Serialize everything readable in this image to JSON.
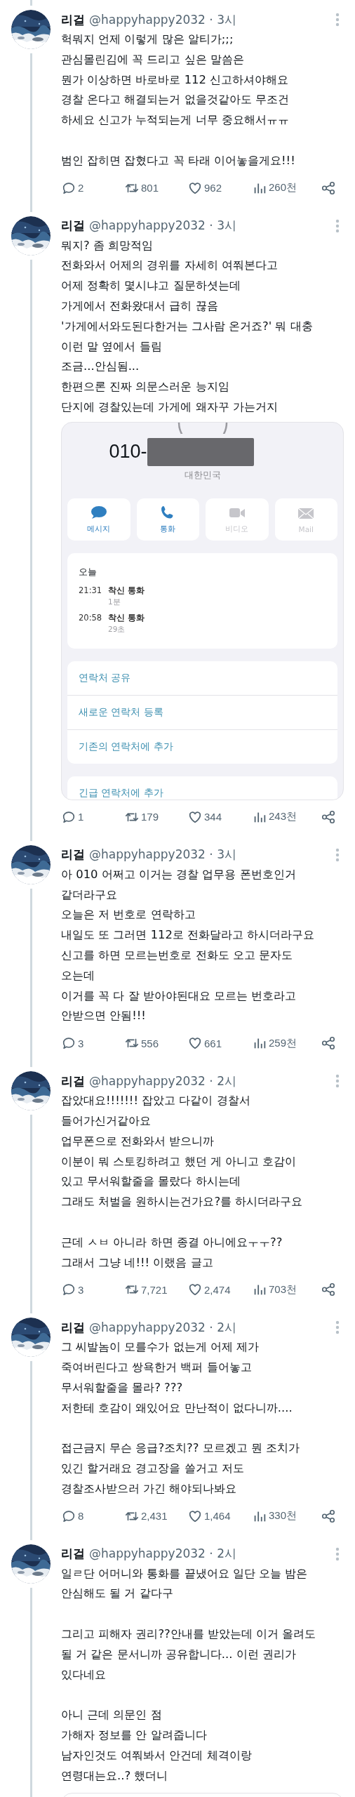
{
  "tweets": [
    {
      "name": "리걸",
      "byline": "@happyhappy2032 · 3시",
      "paragraphs": [
        "헉뭐지 언제 이렇게 많은 알티가;;;\n관심몰린김에 꼭 드리고 싶은 말씀은\n뭔가 이상하면 바로바로 112 신고하셔야해요\n경찰 온다고 해결되는거 없을것같아도 무조건\n하세요 신고가 누적되는게 너무 중요해서ㅠㅠ",
        "범인 잡히면 잡혔다고 꼭 타래 이어놓을게요!!!"
      ],
      "stats": {
        "replies": "2",
        "retweets": "801",
        "likes": "962",
        "views": "260천"
      }
    },
    {
      "name": "리걸",
      "byline": "@happyhappy2032 · 3시",
      "paragraphs": [
        "뭐지? 좀 희망적임\n전화와서 어제의 경위를 자세히 여쭤본다고\n어제 정확히 몇시냐고 질문하셧는데\n가게에서 전화왔대서 급히 끊음\n'가게에서와도된다한거는 그사람 온거죠?' 뭐 대충\n이런 말 옆에서 들림\n조금...안심됨...\n한편으론 진짜 의문스러운 능지임\n단지에 경찰있는데 가게에 왜자꾸 가는거지"
      ],
      "media": {
        "kind": "call_log",
        "number": "010-",
        "redacted": true,
        "region": "대한민국",
        "buttons": [
          {
            "kind": "message",
            "label": "메시지",
            "disabled": false
          },
          {
            "kind": "call",
            "label": "통화",
            "disabled": false
          },
          {
            "kind": "video",
            "label": "비디오",
            "disabled": true
          },
          {
            "kind": "mail",
            "label": "Mail",
            "disabled": true
          }
        ],
        "calls_heading": "오늘",
        "calls": [
          {
            "time": "21:31",
            "type": "착신 통화",
            "duration": "1분"
          },
          {
            "time": "20:58",
            "type": "착신 통화",
            "duration": "29초"
          }
        ],
        "actions": [
          "연락처 공유",
          "새로운 연락처 등록",
          "기존의 연락처에 추가"
        ],
        "emergency_action": "긴급 연락처에 추가"
      },
      "stats": {
        "replies": "1",
        "retweets": "179",
        "likes": "344",
        "views": "243천"
      }
    },
    {
      "name": "리걸",
      "byline": "@happyhappy2032 · 3시",
      "paragraphs": [
        "아 010 어쩌고 이거는 경찰 업무용 폰번호인거\n같더라구요\n오늘은 저 번호로 연락하고\n내일도 또 그러면 112로 전화달라고 하시더라구요\n신고를 하면 모르는번호로 전화도 오고 문자도\n오는데\n이거를 꼭 다 잘 받아야된대요 모르는 번호라고\n안받으면 안됨!!!"
      ],
      "stats": {
        "replies": "3",
        "retweets": "556",
        "likes": "661",
        "views": "259천"
      }
    },
    {
      "name": "리걸",
      "byline": "@happyhappy2032 · 2시",
      "paragraphs": [
        "잡았대요!!!!!!! 잡았고 다같이 경찰서\n들어가신거같아요\n업무폰으로 전화와서 받으니까\n이분이 뭐 스토킹하려고 했던 게 아니고 호감이\n있고 무서워할줄을 몰랐다 하시는데\n그래도 처벌을 원하시는건가요?를 하시더라구요",
        "근데 ㅅㅂ 아니라 하면 종결 아니에요ㅜㅜ??\n그래서 그냥 네!!! 이랬음 글고"
      ],
      "stats": {
        "replies": "3",
        "retweets": "7,721",
        "likes": "2,474",
        "views": "703천"
      }
    },
    {
      "name": "리걸",
      "byline": "@happyhappy2032 · 2시",
      "paragraphs": [
        "그 씨발놈이 모를수가 없는게 어제 제가\n죽여버린다고 쌍욕한거 백퍼 들어놓고\n무서워할줄을 몰라? ???\n저한테 호감이 왜있어요 만난적이 없다니까....",
        "접근금지 무슨 응급?조치?? 모르겠고 뭔 조치가\n있긴 할거래요 경고장을 쓸거고 저도\n경찰조사받으러 가긴 해야되나봐요"
      ],
      "stats": {
        "replies": "8",
        "retweets": "2,431",
        "likes": "1,464",
        "views": "330천"
      }
    },
    {
      "name": "리걸",
      "byline": "@happyhappy2032 · 2시",
      "paragraphs": [
        "일ㄹ단 어머니와 통화를 끝냈어요 일단 오늘 밤은\n안심해도 될 거 같다구",
        "그리고 피해자 권리??안내를 받았는데 이거 올려도\n될 거 같은 문서니까 공유합니다... 이런 권리가\n있다네요",
        "아니 근데 의문인 점\n가해자 정보를 안 알려줍니다\n남자인것도 여쭤봐서 안건데 체격이랑\n연령대는요..? 했더니"
      ],
      "media": {
        "kind": "card"
      }
    }
  ]
}
